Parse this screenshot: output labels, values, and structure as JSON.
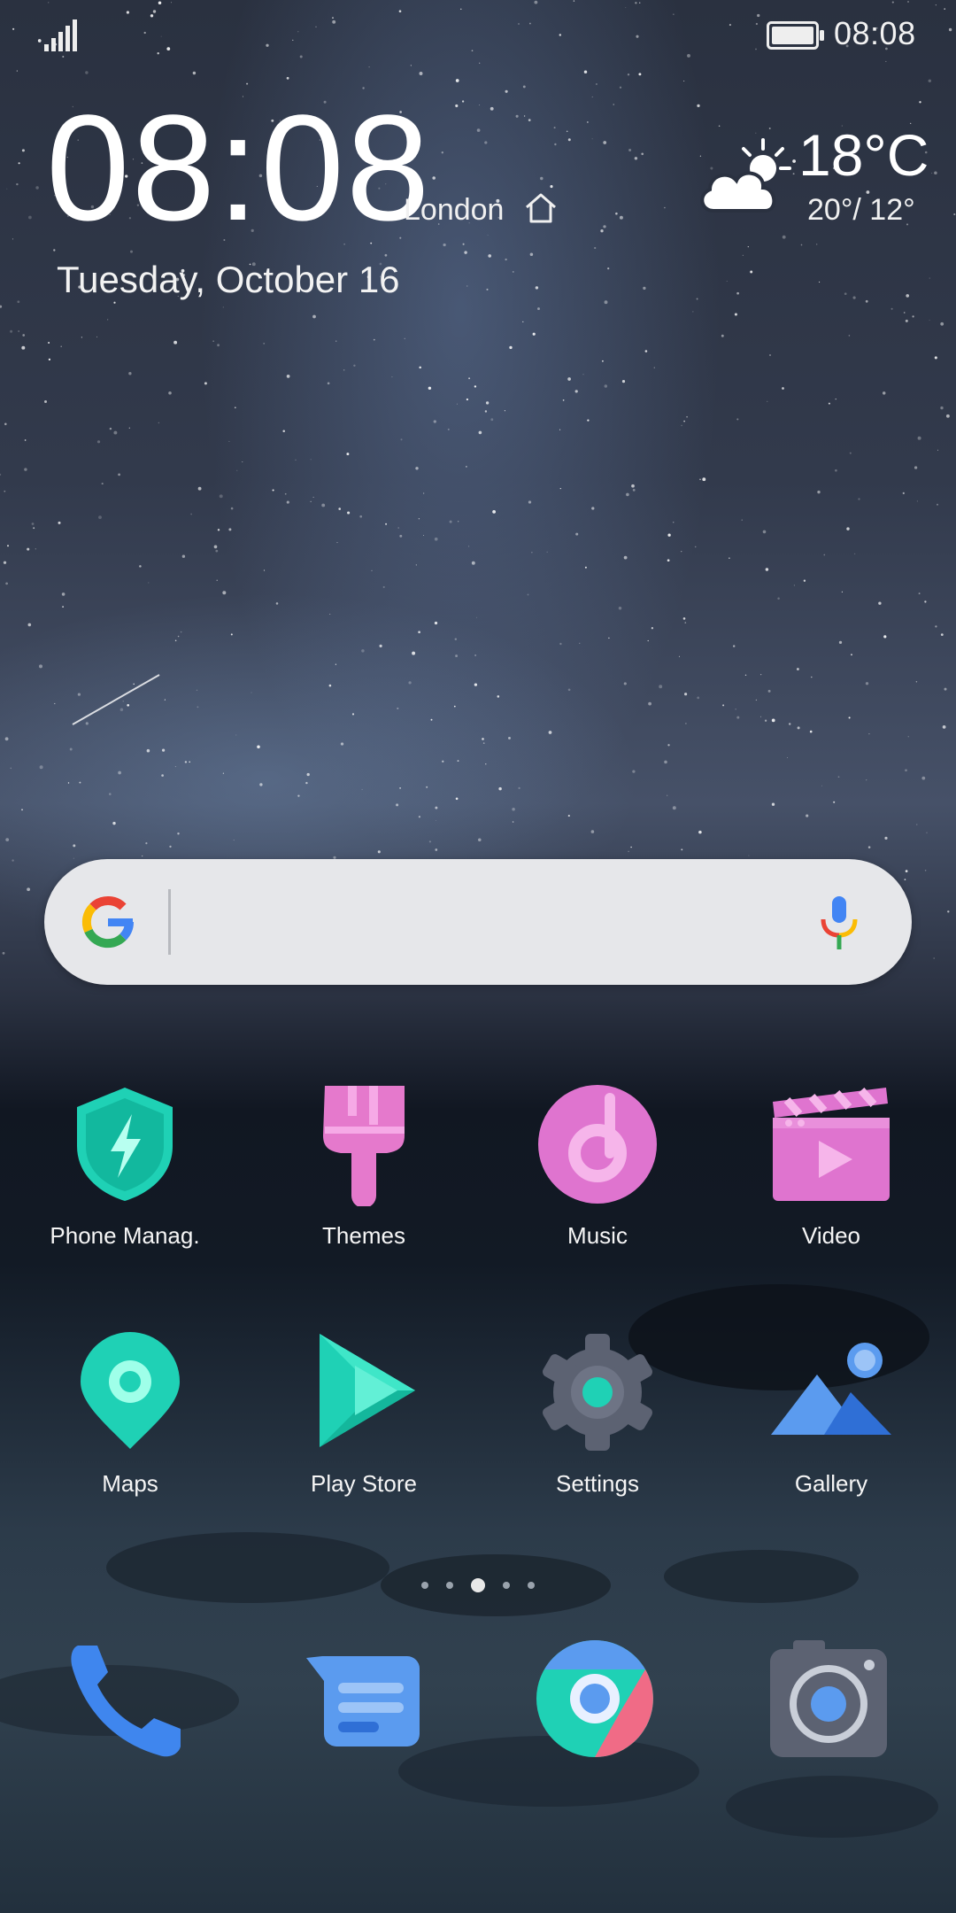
{
  "status_bar": {
    "time": "08:08",
    "signal_icon": "signal-bars-icon",
    "battery_icon": "battery-full-icon"
  },
  "clock_widget": {
    "time": "08:08",
    "city": "London",
    "date": "Tuesday, October 16"
  },
  "weather": {
    "icon": "partly-cloudy-icon",
    "temperature": "18°C",
    "range": "20°/ 12°"
  },
  "search_bar": {
    "logo": "google-logo-icon",
    "voice_icon": "microphone-icon"
  },
  "apps": [
    {
      "label": "Phone Manag.",
      "icon": "phone-manager-icon",
      "color": "#1fd1b5"
    },
    {
      "label": "Themes",
      "icon": "themes-brush-icon",
      "color": "#e579cc"
    },
    {
      "label": "Music",
      "icon": "music-icon",
      "color": "#df74cf"
    },
    {
      "label": "Video",
      "icon": "video-clapper-icon",
      "color": "#df74cf"
    },
    {
      "label": "Maps",
      "icon": "map-pin-icon",
      "color": "#1fd1b5"
    },
    {
      "label": "Play Store",
      "icon": "play-store-icon",
      "color": "#1fd1b5"
    },
    {
      "label": "Settings",
      "icon": "gear-icon",
      "color": "#5c6272"
    },
    {
      "label": "Gallery",
      "icon": "gallery-mountain-icon",
      "color": "#5b9bef"
    }
  ],
  "page_indicator": {
    "count": 5,
    "active": 3
  },
  "dock": [
    {
      "name": "phone",
      "icon": "phone-handset-icon",
      "color": "#3f86ee"
    },
    {
      "name": "messages",
      "icon": "message-bubble-icon",
      "color": "#5b9bef"
    },
    {
      "name": "chrome",
      "icon": "chrome-icon",
      "color": "#1fd1b5"
    },
    {
      "name": "camera",
      "icon": "camera-icon",
      "color": "#5c6272"
    }
  ]
}
